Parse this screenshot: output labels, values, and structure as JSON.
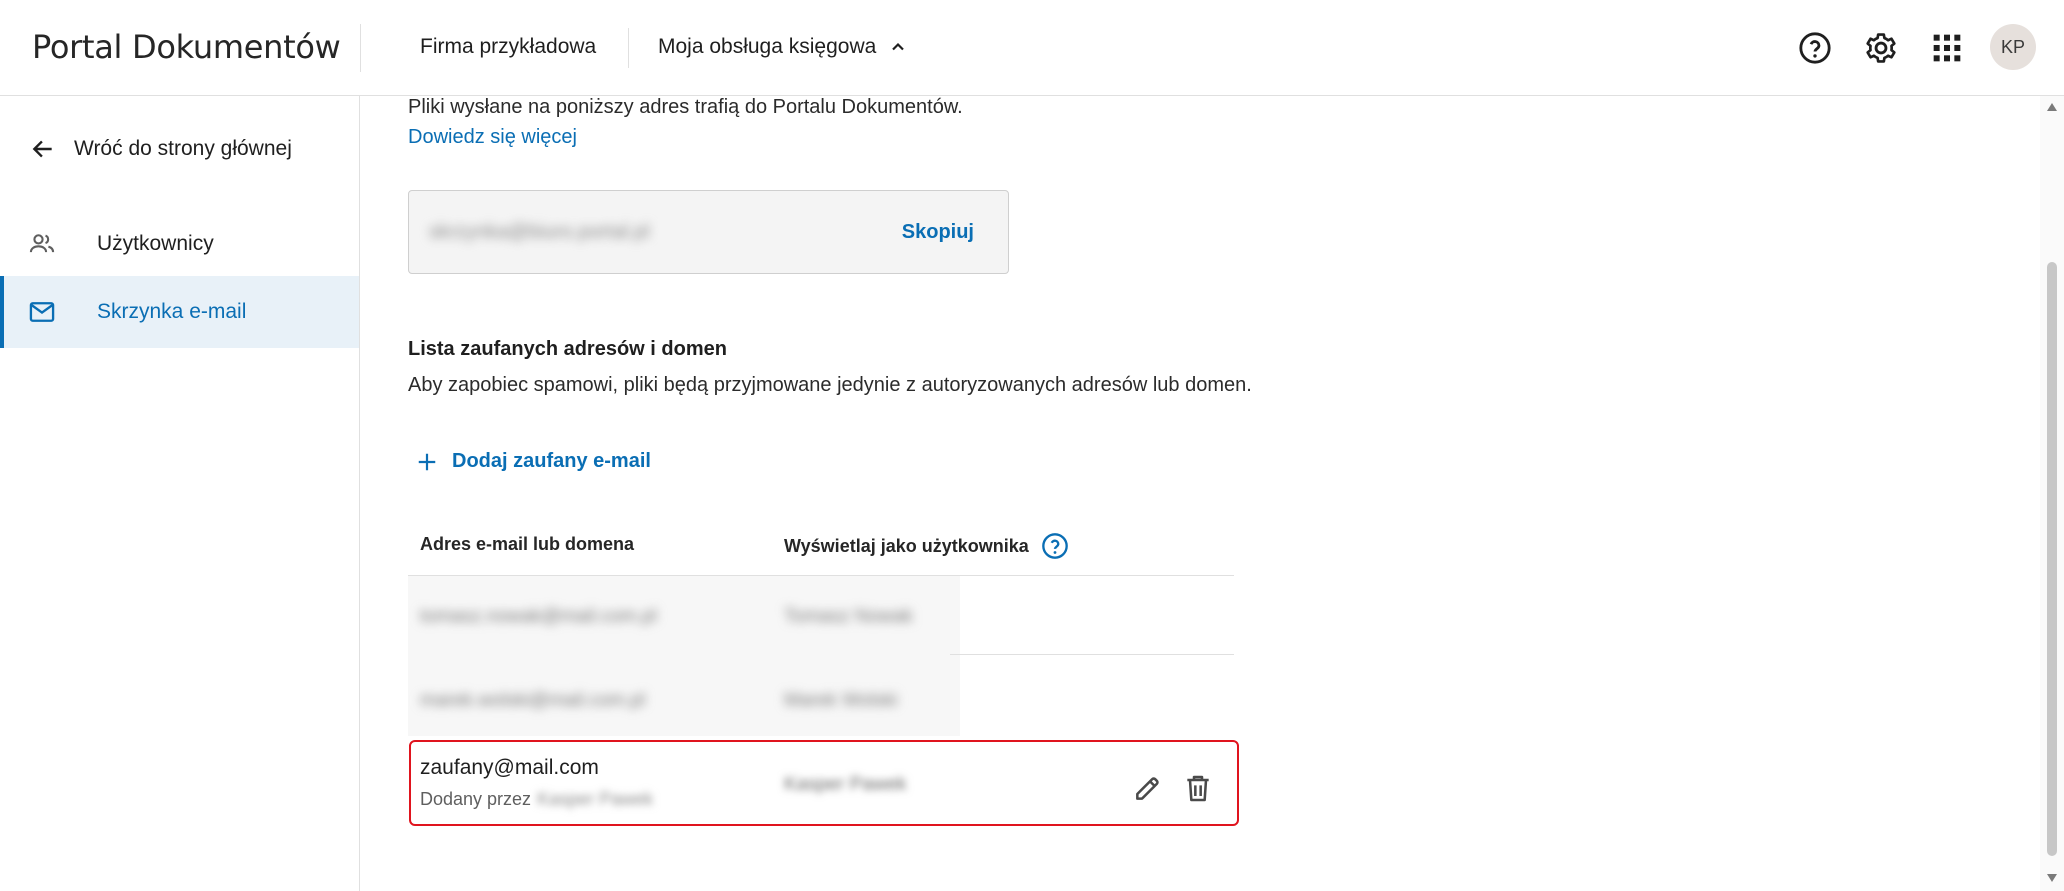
{
  "header": {
    "brand": "Portal Dokumentów",
    "company": "Firma przykładowa",
    "service": "Moja obsługa księgowa",
    "avatar_initials": "KP"
  },
  "sidebar": {
    "back_label": "Wróć do strony głównej",
    "items": [
      {
        "label": "Użytkownicy",
        "icon": "users-icon",
        "active": false
      },
      {
        "label": "Skrzynka e-mail",
        "icon": "mail-icon",
        "active": true
      }
    ]
  },
  "main": {
    "intro": "Pliki wysłane na poniższy adres trafią do Portalu Dokumentów.",
    "learn_more": "Dowiedz się więcej",
    "mailbox_address": "skrzynka@biuro.portal.pl",
    "copy_label": "Skopiuj",
    "section_title": "Lista zaufanych adresów i domen",
    "section_desc": "Aby zapobiec spamowi, pliki będą przyjmowane jedynie z autoryzowanych adresów lub domen.",
    "add_label": "Dodaj zaufany e-mail",
    "columns": [
      "Adres e-mail lub domena",
      "Wyświetlaj jako użytkownika"
    ],
    "rows": [
      {
        "email": "tomasz.nowak@mail.com.pl",
        "user": "Tomasz Nowak"
      },
      {
        "email": "marek.wolski@mail.com.pl",
        "user": "Marek Wolski"
      }
    ],
    "highlighted": {
      "email": "zaufany@mail.com",
      "added_by_prefix": "Dodany przez",
      "added_by_name": "Kasper Pawek",
      "user": "Kasper Pawek"
    }
  },
  "colors": {
    "accent": "#0a6eb4",
    "highlight_border": "#e0141e"
  }
}
